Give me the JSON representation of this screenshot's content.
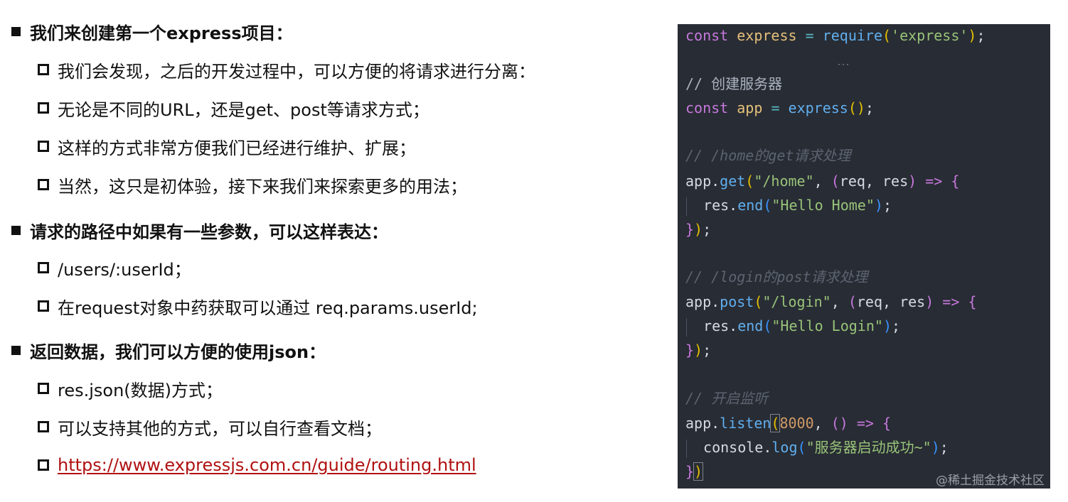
{
  "bullets": [
    {
      "heading": "我们来创建第一个express项目：",
      "items": [
        "我们会发现，之后的开发过程中，可以方便的将请求进行分离：",
        "无论是不同的URL，还是get、post等请求方式；",
        "这样的方式非常方便我们已经进行维护、扩展；",
        "当然，这只是初体验，接下来我们来探索更多的用法；"
      ]
    },
    {
      "heading": "请求的路径中如果有一些参数，可以这样表达：",
      "items": [
        "/users/:userId；",
        "在request对象中药获取可以通过 req.params.userId;"
      ]
    },
    {
      "heading": "返回数据，我们可以方便的使用json：",
      "items": [
        "res.json(数据)方式；",
        "可以支持其他的方式，可以自行查看文档；"
      ],
      "link": "https://www.expressjs.com.cn/guide/routing.html"
    }
  ],
  "code": {
    "lines": [
      "const express = require('express');",
      "",
      "// 创建服务器",
      "const app = express();",
      "",
      "// /home的get请求处理",
      "app.get(\"/home\", (req, res) => {",
      "  res.end(\"Hello Home\");",
      "});",
      "",
      "// /login的post请求处理",
      "app.post(\"/login\", (req, res) => {",
      "  res.end(\"Hello Login\");",
      "});",
      "",
      "// 开启监听",
      "app.listen(8000, () => {",
      "  console.log(\"服务器启动成功~\");",
      "})"
    ],
    "tokens": {
      "kw_const": "const",
      "express": "express",
      "app": "app",
      "eq": "=",
      "require": "require",
      "express_str": "'express'",
      "cm_server": "// 创建服务器",
      "cm_home": "// /home的get请求处理",
      "get": "get",
      "home_str": "\"/home\"",
      "req": "req",
      "res": "res",
      "arrow": "=>",
      "end": "end",
      "hello_home": "\"Hello Home\"",
      "cm_login": "// /login的post请求处理",
      "post": "post",
      "login_str": "\"/login\"",
      "hello_login": "\"Hello Login\"",
      "cm_listen": "// 开启监听",
      "listen": "listen",
      "port": "8000",
      "console": "console",
      "log": "log",
      "success_str": "\"服务器启动成功~\""
    }
  },
  "watermark": "@稀土掘金技术社区",
  "colors": {
    "code_bg": "#282c34",
    "keyword": "#c678dd",
    "variable": "#e5c07b",
    "function": "#61afef",
    "string": "#98c379",
    "comment": "#5c6370",
    "number": "#d19a66",
    "link": "#b01010"
  }
}
